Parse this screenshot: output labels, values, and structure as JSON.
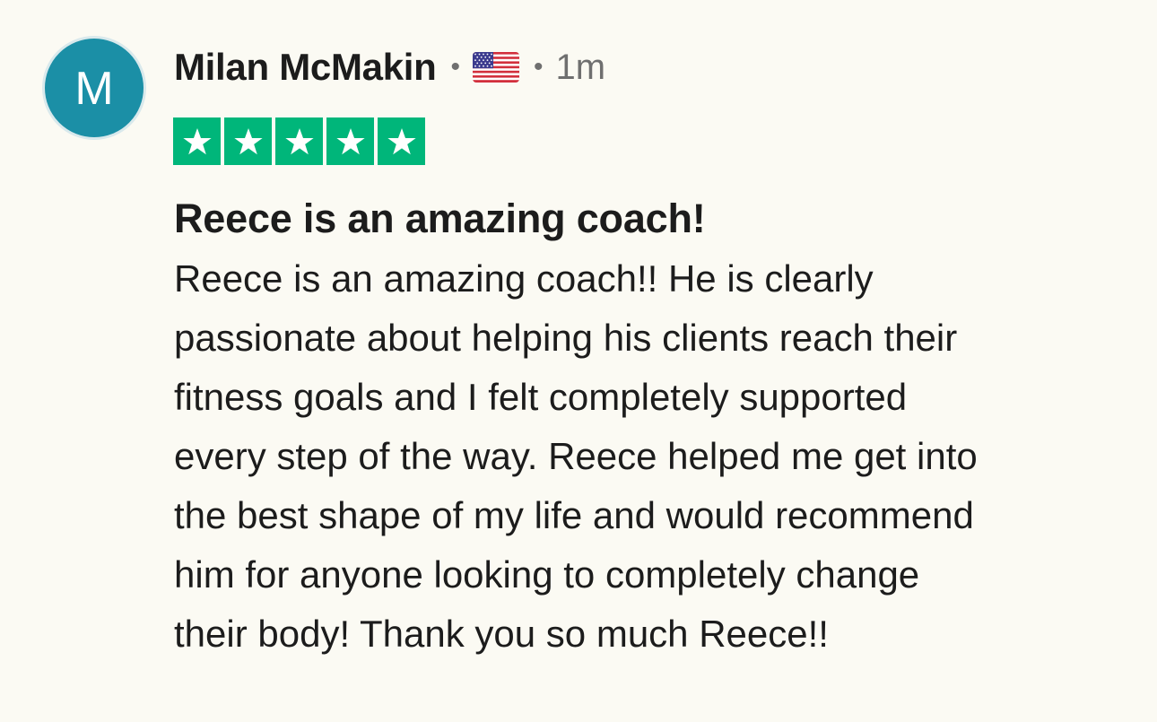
{
  "reviewer": {
    "initial": "M",
    "avatar_color": "#1b8fa6",
    "name": "Milan McMakin",
    "separator": "•",
    "country_icon": "us-flag-icon",
    "time_ago": "1m"
  },
  "rating": {
    "value": 5,
    "max": 5,
    "star_color": "#00b67a",
    "star_icon": "star-icon"
  },
  "review": {
    "title": "Reece is an amazing coach!",
    "lines": [
      "Reece is an amazing coach!! He is clearly",
      "passionate about helping his clients reach their",
      "fitness goals and I felt completely supported",
      "every step of the way. Reece helped me get into",
      "the best shape of my life and would recommend",
      "him for anyone looking to completely change",
      "their body! Thank you so much Reece!!"
    ]
  },
  "colors": {
    "background": "#fbfaf3",
    "text": "#1c1c1c",
    "muted": "#6f6f6f"
  }
}
